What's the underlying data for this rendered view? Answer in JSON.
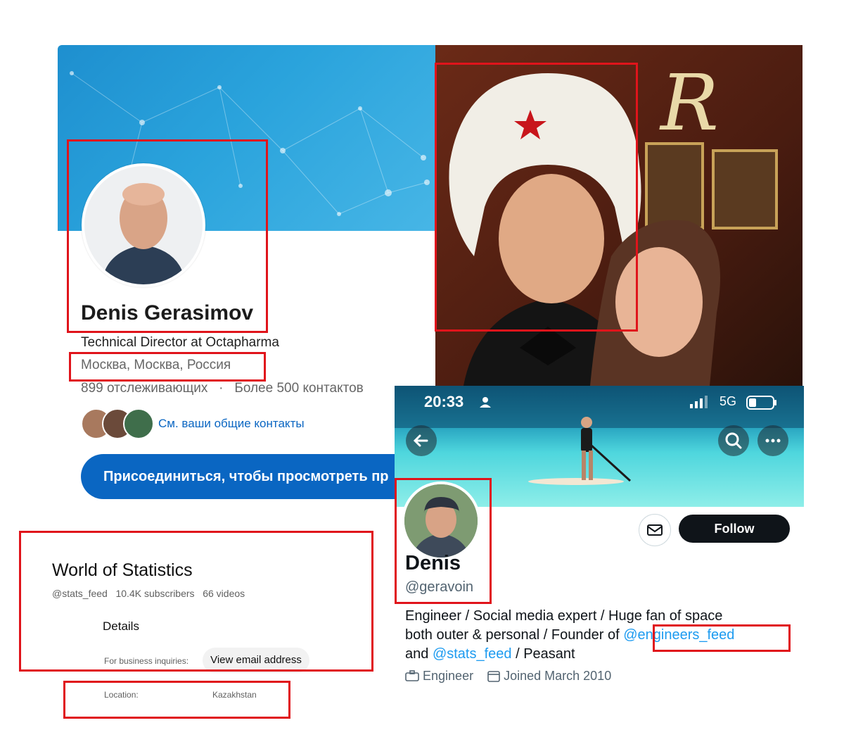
{
  "linkedin": {
    "name": "Denis Gerasimov",
    "headline": "Technical Director at Octapharma",
    "location": "Москва, Москва, Россия",
    "followers": "899 отслеживающих",
    "contacts": "Более 500 контактов",
    "shared_contacts": "См. ваши общие контакты",
    "join_button": "Присоединиться, чтобы просмотреть пр",
    "banner_color": "#2aa3dc",
    "accent": "#0a66c2"
  },
  "photo": {
    "description_icon": "selfie-photo",
    "badge_icon": "red-star-icon"
  },
  "twitter": {
    "time": "20:33",
    "network": "5G",
    "display_name": "Denis",
    "handle": "@geravoin",
    "follow_label": "Follow",
    "bio_line1": "Engineer / Social media expert / Huge fan of space",
    "bio_line2_prefix": "both outer & personal / Founder of ",
    "bio_link1": "@engineers_feed",
    "bio_line3_prefix": "and ",
    "bio_link2": "@stats_feed",
    "bio_line3_suffix": " / Peasant",
    "profession": "Engineer",
    "joined": "Joined March 2010",
    "link_color": "#1d9bf0"
  },
  "youtube": {
    "channel_name": "World of Statistics",
    "handle": "@stats_feed",
    "subscribers": "10.4K subscribers",
    "videos": "66 videos",
    "details_heading": "Details",
    "business_label": "For business inquiries:",
    "email_button": "View email address",
    "location_label": "Location:",
    "location_value": "Kazakhstan"
  },
  "highlight_color": "#e0141b"
}
